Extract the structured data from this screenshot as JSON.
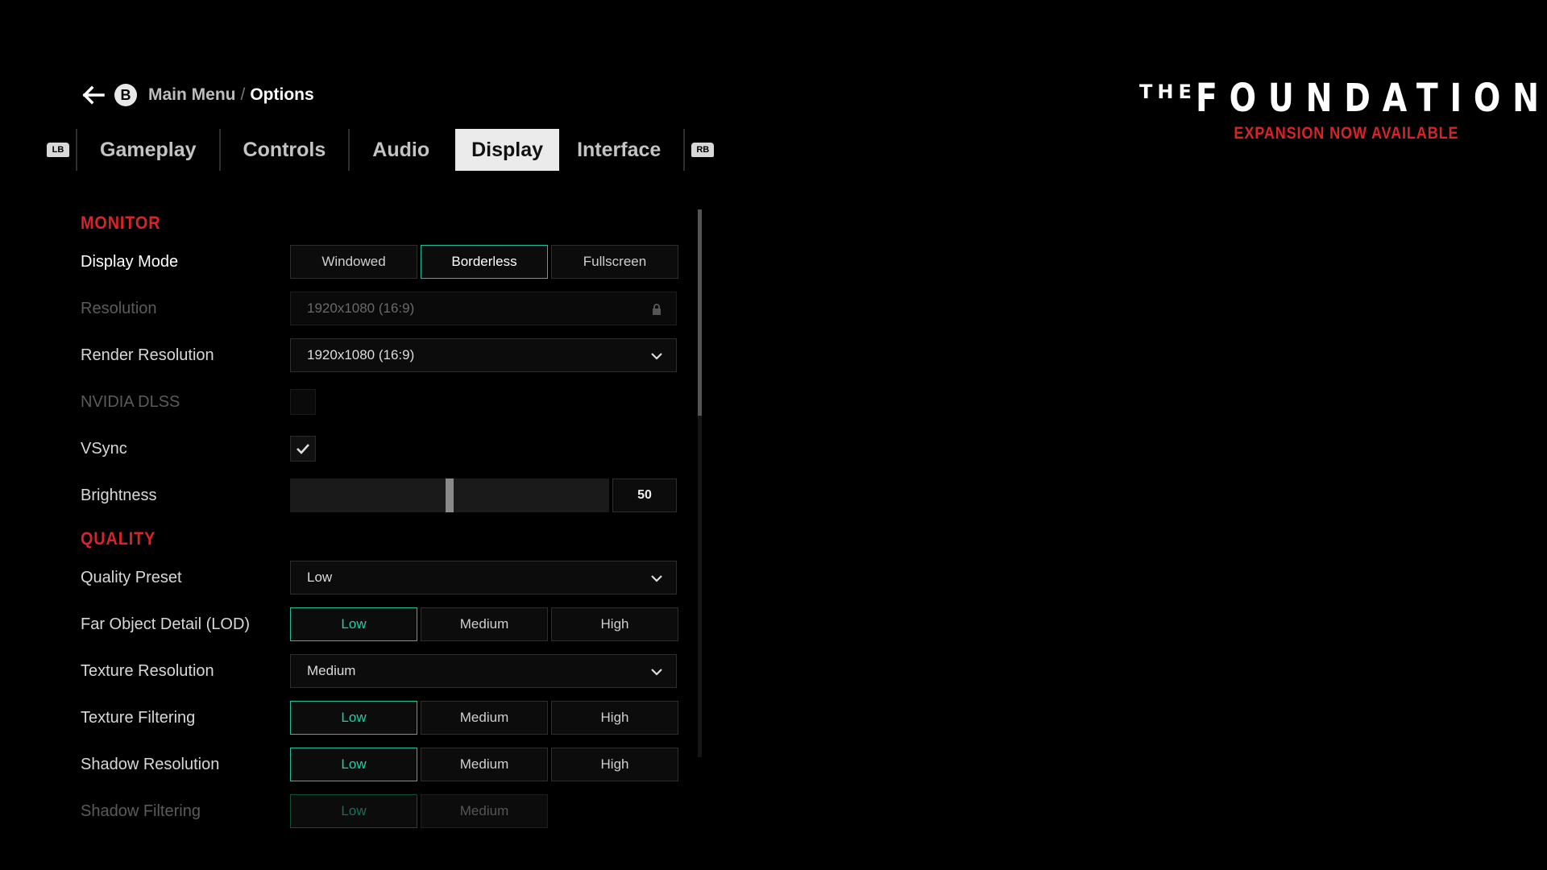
{
  "breadcrumb": {
    "back_hint": "B",
    "parent": "Main Menu",
    "separator": "/",
    "current": "Options"
  },
  "tabs": {
    "left_bumper": "LB",
    "right_bumper": "RB",
    "items": [
      {
        "label": "Gameplay"
      },
      {
        "label": "Controls"
      },
      {
        "label": "Audio"
      },
      {
        "label": "Display",
        "active": true
      },
      {
        "label": "Interface"
      }
    ]
  },
  "logo": {
    "prefix": "THE",
    "title": "FOUNDATION",
    "subtitle": "EXPANSION NOW AVAILABLE"
  },
  "sections": {
    "monitor": "MONITOR",
    "quality": "QUALITY"
  },
  "settings": {
    "display_mode": {
      "label": "Display Mode",
      "options": [
        "Windowed",
        "Borderless",
        "Fullscreen"
      ],
      "selected": "Borderless"
    },
    "resolution": {
      "label": "Resolution",
      "value": "1920x1080 (16:9)",
      "locked": true
    },
    "render_resolution": {
      "label": "Render Resolution",
      "value": "1920x1080 (16:9)"
    },
    "nvidia_dlss": {
      "label": "NVIDIA DLSS",
      "checked": false,
      "disabled": true
    },
    "vsync": {
      "label": "VSync",
      "checked": true
    },
    "brightness": {
      "label": "Brightness",
      "value": "50",
      "fraction": 0.5
    },
    "quality_preset": {
      "label": "Quality Preset",
      "value": "Low"
    },
    "far_object_detail": {
      "label": "Far Object Detail (LOD)",
      "options": [
        "Low",
        "Medium",
        "High"
      ],
      "selected": "Low"
    },
    "texture_resolution": {
      "label": "Texture Resolution",
      "value": "Medium"
    },
    "texture_filtering": {
      "label": "Texture Filtering",
      "options": [
        "Low",
        "Medium",
        "High"
      ],
      "selected": "Low"
    },
    "shadow_resolution": {
      "label": "Shadow Resolution",
      "options": [
        "Low",
        "Medium",
        "High"
      ],
      "selected": "Low"
    },
    "shadow_filtering": {
      "label": "Shadow Filtering",
      "options": [
        "Low",
        "Medium"
      ],
      "selected": "Low",
      "disabled": true
    }
  },
  "colors": {
    "accent_red": "#d8232a",
    "accent_teal": "#1fbf9b",
    "background": "#000000"
  },
  "icons": {
    "back": "arrow-left-icon",
    "dropdown": "chevron-down-icon",
    "lock": "lock-icon",
    "check": "checkmark-icon"
  }
}
